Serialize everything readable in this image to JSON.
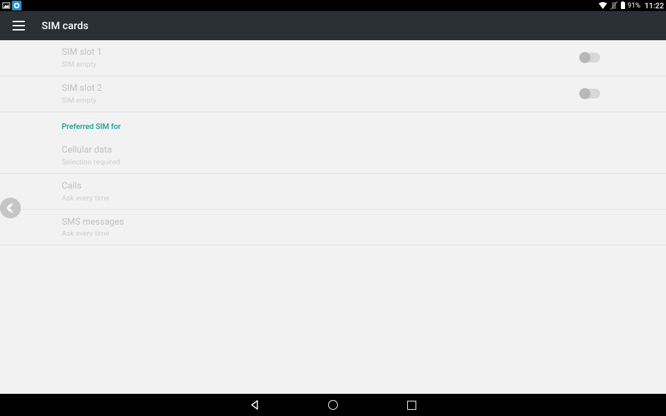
{
  "statusbar": {
    "battery_percent": "91%",
    "time": "11:22"
  },
  "appbar": {
    "title": "SIM cards"
  },
  "slots": [
    {
      "title": "SIM slot 1",
      "subtitle": "SIM empty"
    },
    {
      "title": "SIM slot 2",
      "subtitle": "SIM empty"
    }
  ],
  "section_header": "Preferred SIM for",
  "prefs": [
    {
      "title": "Cellular data",
      "subtitle": "Selection required"
    },
    {
      "title": "Calls",
      "subtitle": "Ask every time"
    },
    {
      "title": "SMS messages",
      "subtitle": "Ask every time"
    }
  ]
}
